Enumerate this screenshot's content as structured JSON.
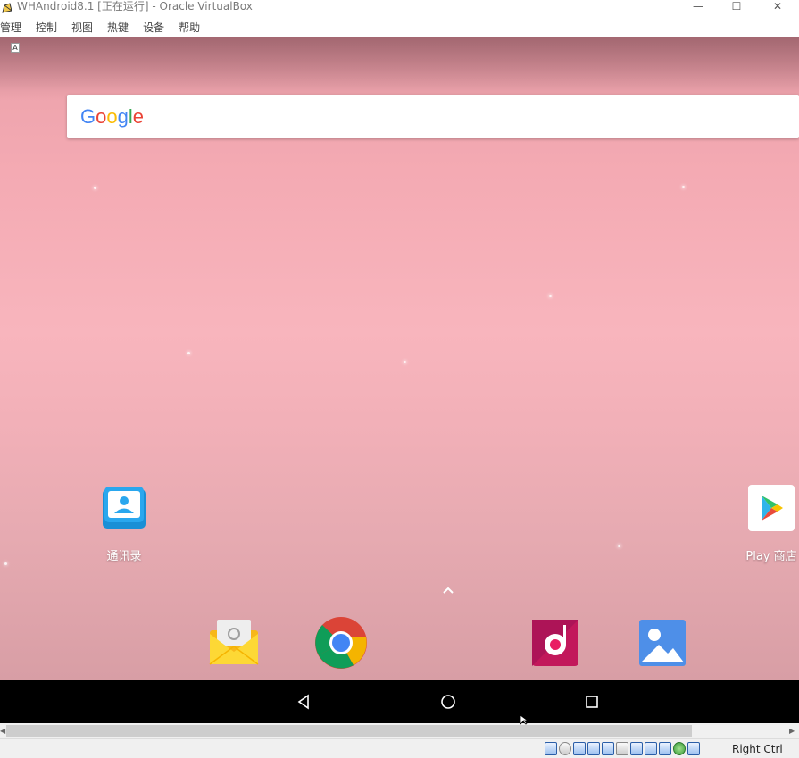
{
  "window": {
    "title": "WHAndroid8.1 [正在运行] - Oracle VirtualBox",
    "minimize_glyph": "—",
    "maximize_glyph": "☐",
    "close_glyph": "✕"
  },
  "menu": {
    "items": [
      "管理",
      "控制",
      "视图",
      "热键",
      "设备",
      "帮助"
    ]
  },
  "android": {
    "keyboard_indicator": "A",
    "search": {
      "logo_letters": [
        "G",
        "o",
        "o",
        "g",
        "l",
        "e"
      ]
    },
    "home_apps": [
      {
        "label": "通讯录",
        "icon": "contacts-icon"
      },
      {
        "label": "Play 商店",
        "icon": "play-store-icon"
      }
    ],
    "dock_apps": [
      {
        "icon": "email-icon"
      },
      {
        "icon": "chrome-icon"
      },
      {
        "icon": "music-icon"
      },
      {
        "icon": "gallery-icon"
      }
    ],
    "navbar": {
      "icons": [
        "back-icon",
        "home-icon",
        "recents-icon"
      ]
    }
  },
  "scrollbar": {
    "left_glyph": "◀",
    "right_glyph": "▶"
  },
  "statusbar": {
    "host_key_label": "Right Ctrl"
  },
  "colors": {
    "wallpaper_top": "#c07f88",
    "wallpaper_mid": "#f8b5bd",
    "navbar": "#000000",
    "google_blue": "#4285F4",
    "google_red": "#EA4335",
    "google_yellow": "#FBBC05",
    "google_green": "#34A853"
  }
}
